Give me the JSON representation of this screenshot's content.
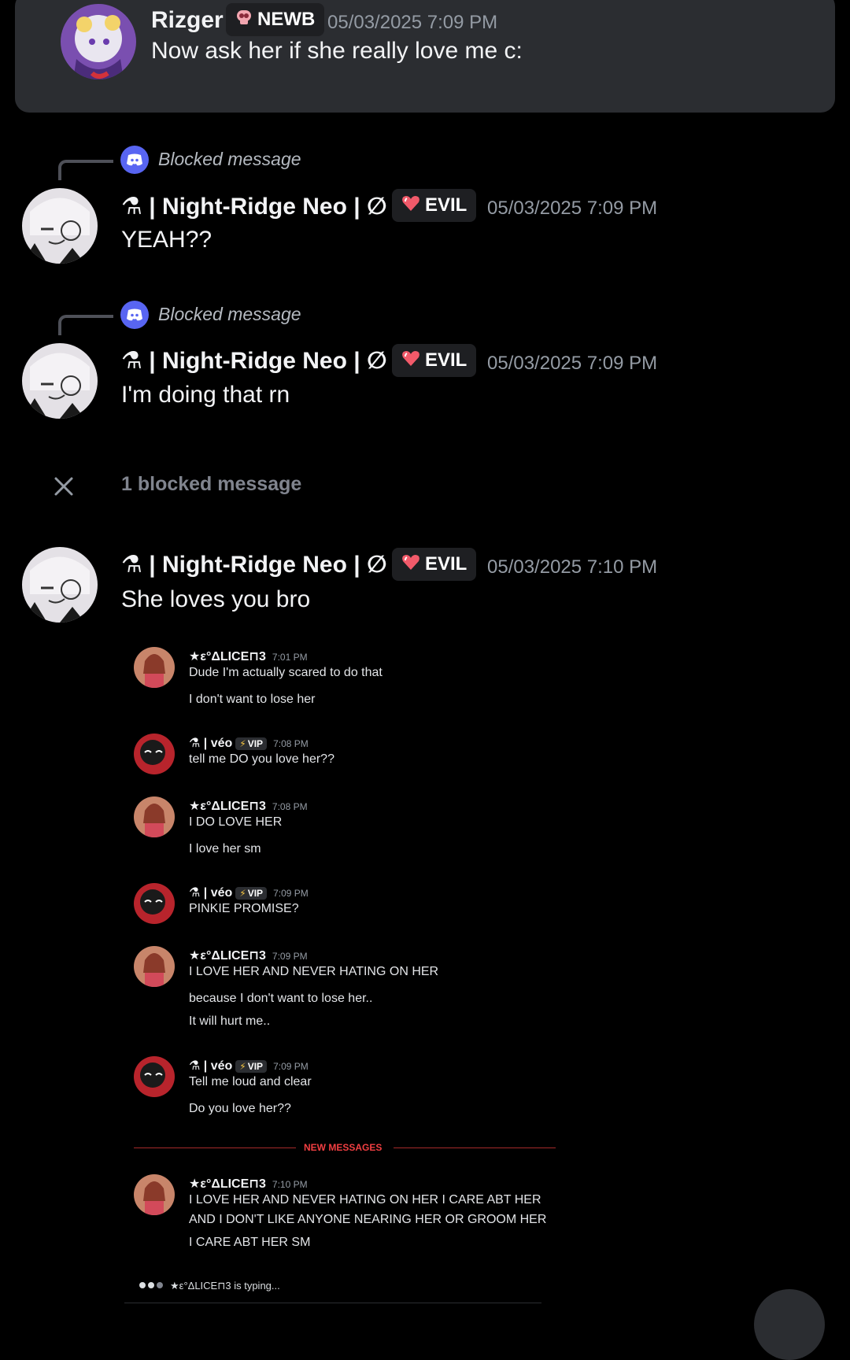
{
  "top_message": {
    "username": "Rizger",
    "tag": "NEWB",
    "timestamp": "05/03/2025 7:09 PM",
    "text": "Now ask her if she really love me c:"
  },
  "messages": [
    {
      "reply_label": "Blocked message",
      "username": "⚗ | Night-Ridge Neo | ∅",
      "tag": "EVIL",
      "timestamp": "05/03/2025 7:09 PM",
      "text": "YEAH??"
    },
    {
      "reply_label": "Blocked message",
      "username": "⚗ | Night-Ridge Neo | ∅",
      "tag": "EVIL",
      "timestamp": "05/03/2025 7:09 PM",
      "text": "I'm doing that rn"
    }
  ],
  "blocked_banner": {
    "text": "1 blocked message"
  },
  "last_message": {
    "username": "⚗ | Night-Ridge Neo | ∅",
    "tag": "EVIL",
    "timestamp": "05/03/2025 7:10 PM",
    "text": "She loves you bro"
  },
  "embed": {
    "groups": [
      {
        "author": "★ε°ΔLICE⊓3",
        "time": "7:01 PM",
        "vip": "",
        "lines": [
          "Dude I'm actually scared to do that",
          "I don't want to lose her"
        ]
      },
      {
        "author": "⚗ | véo",
        "time": "7:08 PM",
        "vip": "VIP",
        "lines": [
          "tell me DO you love her??"
        ]
      },
      {
        "author": "★ε°ΔLICE⊓3",
        "time": "7:08 PM",
        "vip": "",
        "lines": [
          "I DO LOVE HER",
          "I love her sm"
        ]
      },
      {
        "author": "⚗ | véo",
        "time": "7:09 PM",
        "vip": "VIP",
        "lines": [
          "PINKIE PROMISE?"
        ]
      },
      {
        "author": "★ε°ΔLICE⊓3",
        "time": "7:09 PM",
        "vip": "",
        "lines": [
          "I LOVE HER AND NEVER HATING ON HER",
          "because I don't want to lose her..",
          "It will hurt me.."
        ]
      },
      {
        "author": "⚗ | véo",
        "time": "7:09 PM",
        "vip": "VIP",
        "lines": [
          "Tell me loud and clear",
          "Do you love her??"
        ]
      }
    ],
    "new_messages_label": "NEW MESSAGES",
    "after_divider": {
      "author": "★ε°ΔLICE⊓3",
      "time": "7:10 PM",
      "lines": [
        "I LOVE HER AND NEVER HATING ON HER I CARE ABT HER",
        "AND I DON'T LIKE ANYONE NEARING HER OR GROOM HER",
        "I CARE ABT HER SM"
      ]
    },
    "typing": "★ε°ΔLICE⊓3 is typing..."
  },
  "colors": {
    "background": "#000000",
    "card": "#2b2d31",
    "blurple": "#5865f2",
    "new_messages": "#f23f42"
  }
}
